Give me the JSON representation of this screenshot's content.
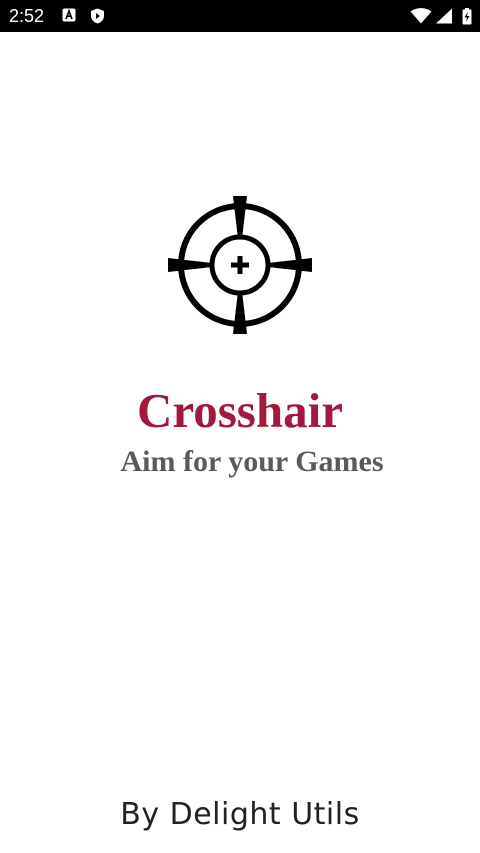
{
  "status_bar": {
    "time": "2:52",
    "icons_left": [
      "a-notification-icon",
      "shield-icon"
    ],
    "icons_right": [
      "wifi-icon",
      "signal-icon",
      "battery-charging-icon"
    ]
  },
  "splash": {
    "logo_icon": "crosshair-icon",
    "title": "Crosshair",
    "tagline": "Aim for your Games",
    "footer": "By Delight Utils"
  },
  "colors": {
    "title": "#a3193c",
    "tagline": "#5a5a5a",
    "footer": "#222222",
    "status_bar_bg": "#000000",
    "background": "#ffffff"
  }
}
